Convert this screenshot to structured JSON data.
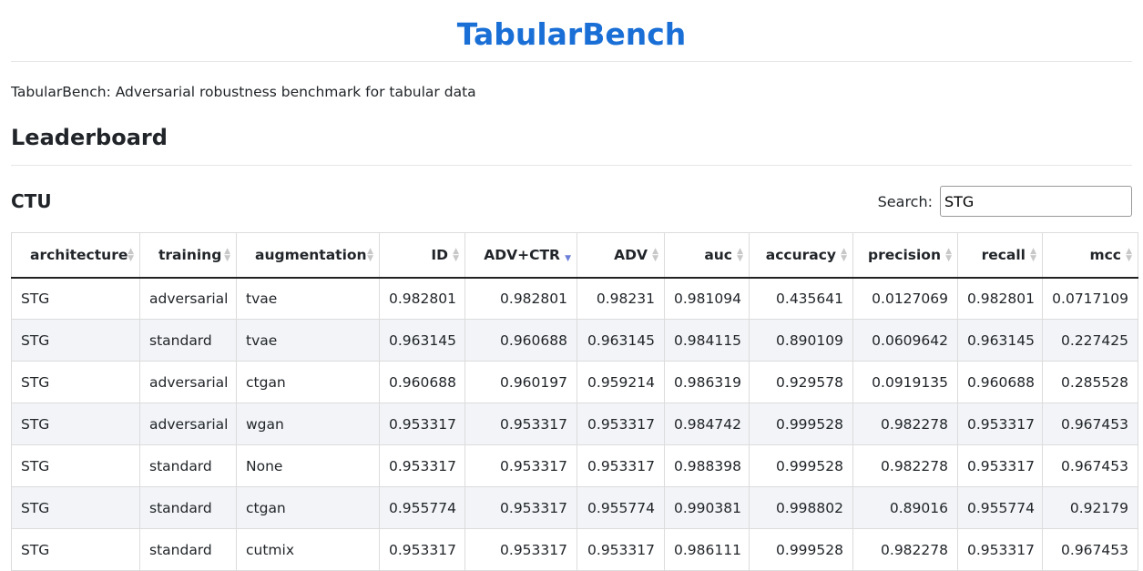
{
  "header": {
    "title": "TabularBench"
  },
  "description": "TabularBench: Adversarial robustness benchmark for tabular data",
  "section": {
    "title": "Leaderboard"
  },
  "dataset": {
    "name": "CTU"
  },
  "search": {
    "label": "Search:",
    "value": "STG"
  },
  "table": {
    "columns": [
      "architecture",
      "training",
      "augmentation",
      "ID",
      "ADV+CTR",
      "ADV",
      "auc",
      "accuracy",
      "precision",
      "recall",
      "mcc"
    ],
    "sorted_column": "ADV+CTR",
    "sort_direction": "descending",
    "rows": [
      [
        "STG",
        "adversarial",
        "tvae",
        "0.982801",
        "0.982801",
        "0.98231",
        "0.981094",
        "0.435641",
        "0.0127069",
        "0.982801",
        "0.0717109"
      ],
      [
        "STG",
        "standard",
        "tvae",
        "0.963145",
        "0.960688",
        "0.963145",
        "0.984115",
        "0.890109",
        "0.0609642",
        "0.963145",
        "0.227425"
      ],
      [
        "STG",
        "adversarial",
        "ctgan",
        "0.960688",
        "0.960197",
        "0.959214",
        "0.986319",
        "0.929578",
        "0.0919135",
        "0.960688",
        "0.285528"
      ],
      [
        "STG",
        "adversarial",
        "wgan",
        "0.953317",
        "0.953317",
        "0.953317",
        "0.984742",
        "0.999528",
        "0.982278",
        "0.953317",
        "0.967453"
      ],
      [
        "STG",
        "standard",
        "None",
        "0.953317",
        "0.953317",
        "0.953317",
        "0.988398",
        "0.999528",
        "0.982278",
        "0.953317",
        "0.967453"
      ],
      [
        "STG",
        "standard",
        "ctgan",
        "0.955774",
        "0.953317",
        "0.955774",
        "0.990381",
        "0.998802",
        "0.89016",
        "0.955774",
        "0.92179"
      ],
      [
        "STG",
        "standard",
        "cutmix",
        "0.953317",
        "0.953317",
        "0.953317",
        "0.986111",
        "0.999528",
        "0.982278",
        "0.953317",
        "0.967453"
      ]
    ]
  },
  "colors": {
    "title": "#1a6fd6",
    "row_alt": "#f2f4f7",
    "sort_active": "#6c7fd8"
  }
}
